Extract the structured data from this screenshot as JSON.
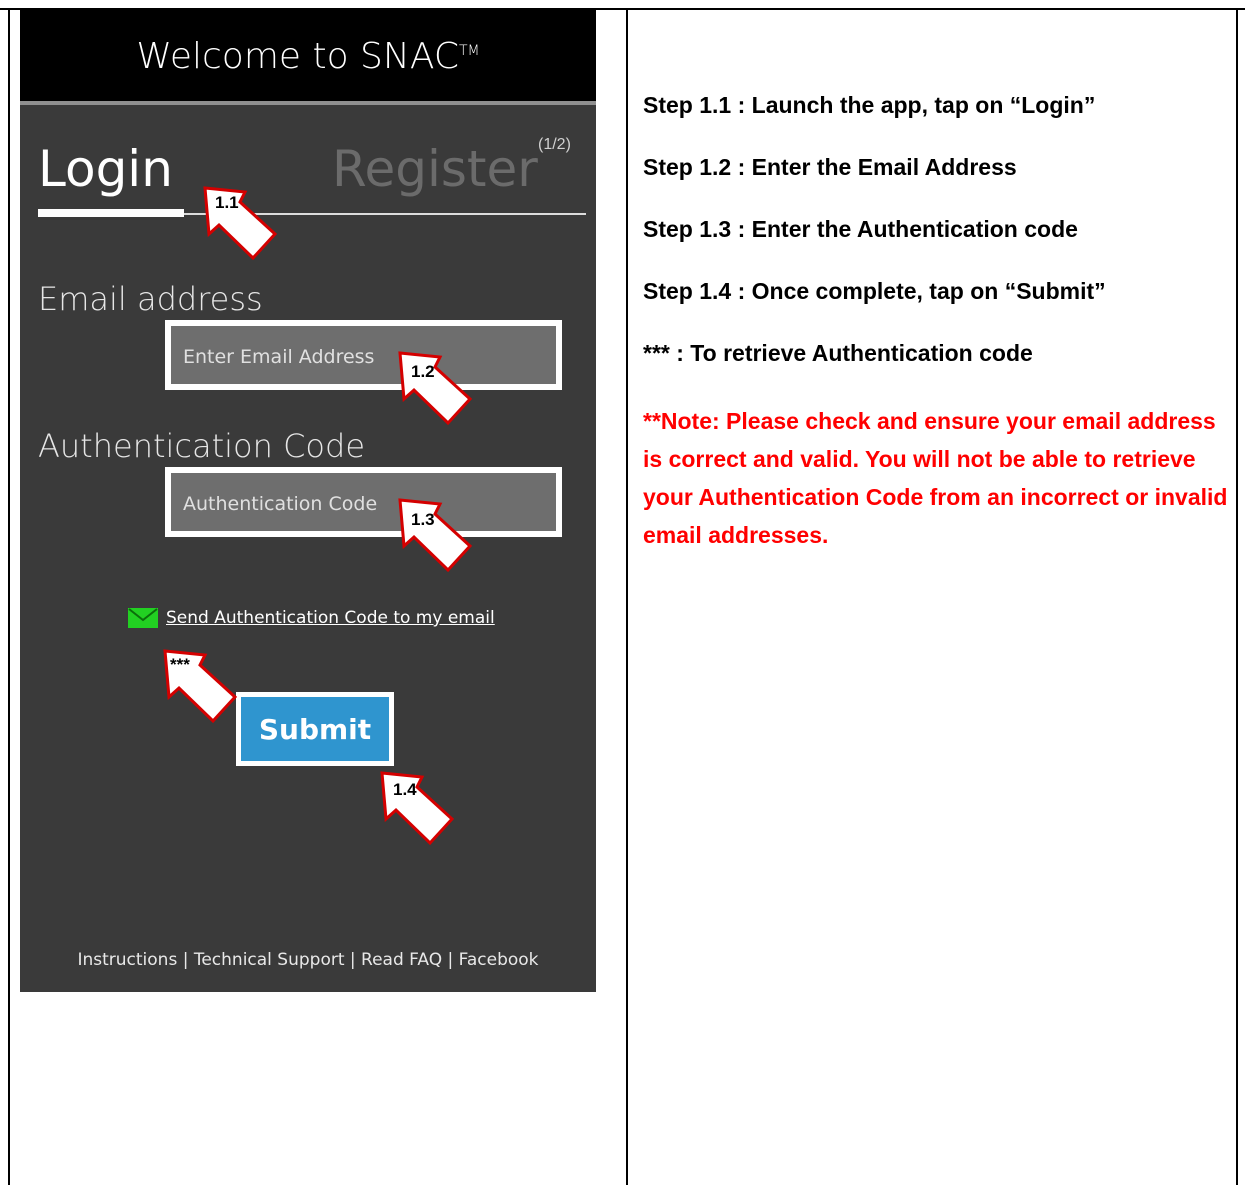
{
  "app": {
    "header_title": "Welcome to SNAC",
    "trademark": "TM"
  },
  "tabs": {
    "login": "Login",
    "register": "Register",
    "register_counter": "(1/2)"
  },
  "form": {
    "email_label": "Email address",
    "email_placeholder": "Enter Email Address",
    "auth_label": "Authentication Code",
    "auth_placeholder": "Authentication Code",
    "send_code_link": "Send Authentication Code to my email",
    "submit_label": "Submit"
  },
  "footer": {
    "links": "Instructions | Technical Support | Read FAQ | Facebook"
  },
  "callouts": {
    "c1": "1.1",
    "c2": "1.2",
    "c3": "1.3",
    "c4": "1.4",
    "c5": "***"
  },
  "steps": [
    "Step 1.1 : Launch the app, tap on “Login”",
    "Step 1.2 : Enter the Email Address",
    "Step 1.3 : Enter the Authentication code",
    "Step 1.4 : Once complete, tap on “Submit”",
    "*** : To retrieve Authentication code"
  ],
  "note": "**Note: Please check and ensure your email address is correct and valid. You will not be able to retrieve your Authentication Code from an incorrect or invalid email addresses.",
  "colors": {
    "accent": "#2f95cf",
    "note_red": "#ff0000",
    "mail_green": "#22d022",
    "callout_red": "#d40000"
  },
  "icons": [
    "mail-icon",
    "arrow-pointer-icon"
  ]
}
